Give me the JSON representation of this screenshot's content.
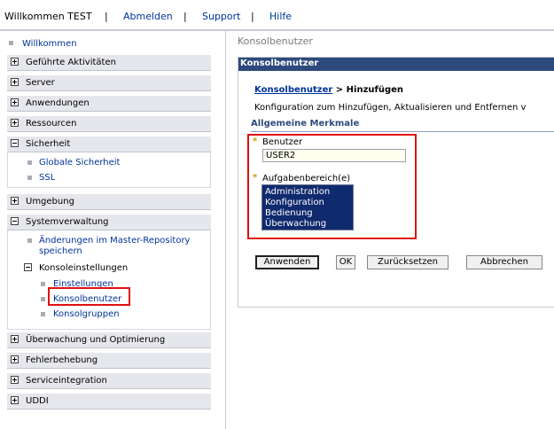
{
  "topbar": {
    "welcome": "Willkommen TEST",
    "logout": "Abmelden",
    "support": "Support",
    "help": "Hilfe",
    "separator": "|"
  },
  "nav": {
    "welcome_link": "Willkommen",
    "categories": [
      {
        "label": "Geführte Aktivitäten",
        "state": "collapsed"
      },
      {
        "label": "Server",
        "state": "collapsed"
      },
      {
        "label": "Anwendungen",
        "state": "collapsed"
      },
      {
        "label": "Ressourcen",
        "state": "collapsed"
      },
      {
        "label": "Sicherheit",
        "state": "expanded"
      },
      {
        "label": "Umgebung",
        "state": "collapsed"
      },
      {
        "label": "Systemverwaltung",
        "state": "expanded"
      },
      {
        "label": "Überwachung und Optimierung",
        "state": "collapsed"
      },
      {
        "label": "Fehlerbehebung",
        "state": "collapsed"
      },
      {
        "label": "Serviceintegration",
        "state": "collapsed"
      },
      {
        "label": "UDDI",
        "state": "collapsed"
      }
    ],
    "security_items": [
      "Globale Sicherheit",
      "SSL"
    ],
    "sysadmin": {
      "changes_line1": "Änderungen im Master-Repository",
      "changes_line2": "speichern",
      "console_settings": "Konsoleinstellungen",
      "console_items": [
        "Einstellungen",
        "Konsolbenutzer",
        "Konsolgruppen"
      ]
    }
  },
  "main": {
    "page_title": "Konsolbenutzer",
    "panel_title": "Konsolbenutzer",
    "breadcrumb_link": "Konsolbenutzer",
    "breadcrumb_rest": " > Hinzufügen",
    "description": "Konfiguration zum Hinzufügen, Aktualisieren und Entfernen v",
    "section_title": "Allgemeine Merkmale",
    "required_marker": "*",
    "user_label": "Benutzer",
    "user_value": "USER2",
    "roles_label": "Aufgabenbereich(e)",
    "roles": [
      "Administration",
      "Konfiguration",
      "Bedienung",
      "Überwachung"
    ],
    "buttons": {
      "apply": "Anwenden",
      "ok": "OK",
      "reset": "Zurücksetzen",
      "cancel": "Abbrechen"
    }
  },
  "colors": {
    "panel_header": "#2d4a7c",
    "link": "#003399",
    "highlight": "#e01010",
    "listbox_bg": "#102a6e"
  }
}
